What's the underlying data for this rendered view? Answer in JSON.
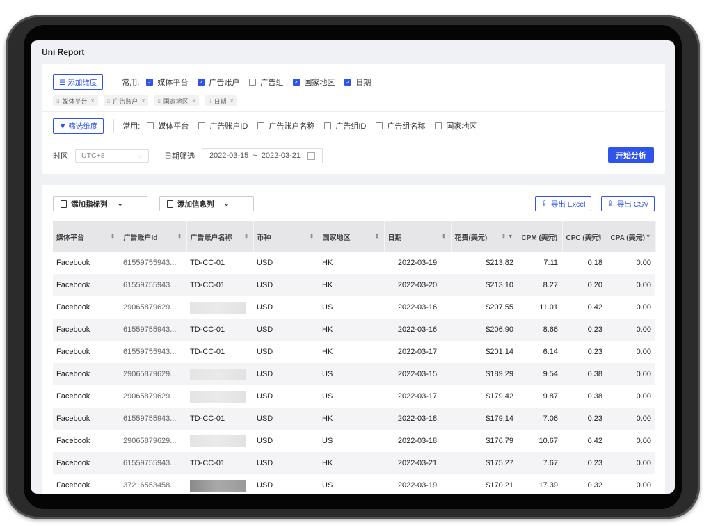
{
  "app": {
    "title": "Uni Report"
  },
  "dimensions": {
    "add_button": "☰ 添加维度",
    "common_label": "常用:",
    "options": [
      {
        "label": "媒体平台",
        "checked": true
      },
      {
        "label": "广告账户",
        "checked": true
      },
      {
        "label": "广告组",
        "checked": false
      },
      {
        "label": "国家地区",
        "checked": true
      },
      {
        "label": "日期",
        "checked": true
      }
    ],
    "tags": [
      "媒体平台",
      "广告账户",
      "国家地区",
      "日期"
    ]
  },
  "filters": {
    "button": "▼ 筛选维度",
    "common_label": "常用:",
    "options": [
      "媒体平台",
      "广告账户ID",
      "广告账户名称",
      "广告组ID",
      "广告组名称",
      "国家地区"
    ]
  },
  "controls": {
    "timezone_label": "时区",
    "timezone_value": "UTC+8",
    "date_label": "日期筛选",
    "date_start": "2022-03-15",
    "date_sep": "~",
    "date_end": "2022-03-21",
    "analyze_button": "开始分析"
  },
  "toolbar": {
    "add_metric": "添加指标列",
    "add_info": "添加信息列",
    "export_excel": "导出 Excel",
    "export_csv": "导出 CSV"
  },
  "table": {
    "headers": [
      "媒体平台",
      "广告账户Id",
      "广告账户名称",
      "币种",
      "国家地区",
      "日期",
      "花费(美元)",
      "CPM (美元)",
      "CPC (美元)",
      "CPA (美元)"
    ],
    "rows": [
      [
        "Facebook",
        "61559755943...",
        "TD-CC-01",
        "USD",
        "HK",
        "2022-03-19",
        "$213.82",
        "7.11",
        "0.18",
        "0.00"
      ],
      [
        "Facebook",
        "61559755943...",
        "TD-CC-01",
        "USD",
        "HK",
        "2022-03-20",
        "$213.10",
        "8.27",
        "0.20",
        "0.00"
      ],
      [
        "Facebook",
        "29065879629...",
        "",
        "USD",
        "US",
        "2022-03-16",
        "$207.55",
        "11.01",
        "0.42",
        "0.00"
      ],
      [
        "Facebook",
        "61559755943...",
        "TD-CC-01",
        "USD",
        "HK",
        "2022-03-16",
        "$206.90",
        "8.66",
        "0.23",
        "0.00"
      ],
      [
        "Facebook",
        "61559755943...",
        "TD-CC-01",
        "USD",
        "HK",
        "2022-03-17",
        "$201.14",
        "6.14",
        "0.23",
        "0.00"
      ],
      [
        "Facebook",
        "29065879629...",
        "",
        "USD",
        "US",
        "2022-03-15",
        "$189.29",
        "9.54",
        "0.38",
        "0.00"
      ],
      [
        "Facebook",
        "29065879629...",
        "",
        "USD",
        "US",
        "2022-03-17",
        "$179.42",
        "9.87",
        "0.38",
        "0.00"
      ],
      [
        "Facebook",
        "61559755943...",
        "TD-CC-01",
        "USD",
        "HK",
        "2022-03-18",
        "$179.14",
        "7.06",
        "0.23",
        "0.00"
      ],
      [
        "Facebook",
        "29065879629...",
        "",
        "USD",
        "US",
        "2022-03-18",
        "$176.79",
        "10.67",
        "0.42",
        "0.00"
      ],
      [
        "Facebook",
        "61559755943...",
        "TD-CC-01",
        "USD",
        "HK",
        "2022-03-21",
        "$175.27",
        "7.67",
        "0.23",
        "0.00"
      ],
      [
        "Facebook",
        "37216553458...",
        "",
        "USD",
        "US",
        "2022-03-19",
        "$170.21",
        "17.39",
        "0.32",
        "0.00"
      ]
    ]
  },
  "colors": {
    "accent": "#2f54eb",
    "header_bg": "#e6e6e9"
  }
}
